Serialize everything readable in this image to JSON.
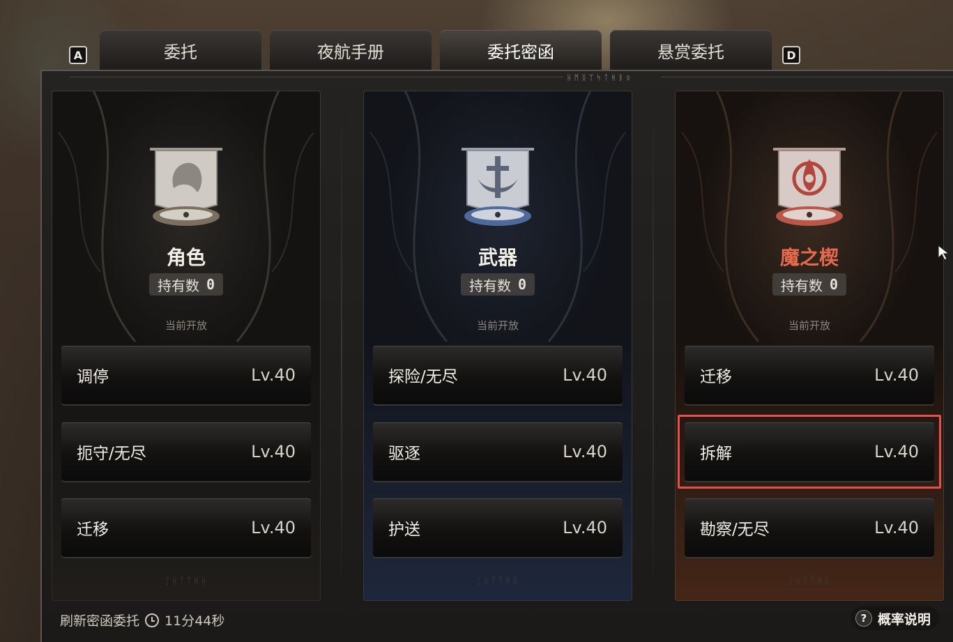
{
  "keys": {
    "left": "A",
    "right": "D"
  },
  "tabs": [
    {
      "label": "委托",
      "active": false
    },
    {
      "label": "夜航手册",
      "active": false
    },
    {
      "label": "委托密函",
      "active": true
    },
    {
      "label": "悬赏委托",
      "active": false
    }
  ],
  "categories": [
    {
      "title": "角色",
      "owned_label": "持有数",
      "owned_count": "0",
      "status": "当前开放",
      "emblem_icon": "character-silhouette-icon",
      "missions": [
        {
          "name": "调停",
          "level": "Lv.40"
        },
        {
          "name": "扼守/无尽",
          "level": "Lv.40"
        },
        {
          "name": "迁移",
          "level": "Lv.40"
        }
      ]
    },
    {
      "title": "武器",
      "owned_label": "持有数",
      "owned_count": "0",
      "status": "当前开放",
      "emblem_icon": "sword-icon",
      "missions": [
        {
          "name": "探险/无尽",
          "level": "Lv.40"
        },
        {
          "name": "驱逐",
          "level": "Lv.40"
        },
        {
          "name": "护送",
          "level": "Lv.40"
        }
      ]
    },
    {
      "title": "魔之楔",
      "owned_label": "持有数",
      "owned_count": "0",
      "status": "当前开放",
      "emblem_icon": "triquetra-icon",
      "accent": "#e86a4e",
      "missions": [
        {
          "name": "迁移",
          "level": "Lv.40"
        },
        {
          "name": "拆解",
          "level": "Lv.40"
        },
        {
          "name": "勘察/无尽",
          "level": "Lv.40"
        }
      ]
    }
  ],
  "footer": {
    "refresh_label": "刷新密函委托",
    "timer": "11分44秒",
    "probability_label": "概率说明"
  },
  "colors": {
    "highlight": "#e2514d",
    "demon_accent": "#e86a4e",
    "active_tab_underline": "#f4e8c8"
  }
}
